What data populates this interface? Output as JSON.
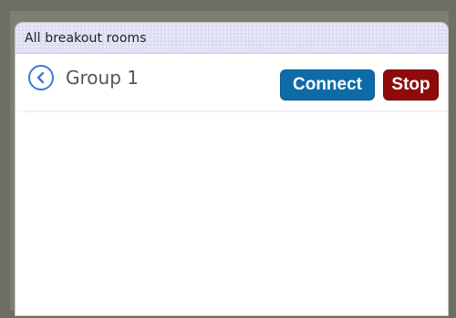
{
  "panel": {
    "title": "All breakout rooms"
  },
  "room": {
    "name": "Group 1",
    "connect_label": "Connect",
    "stop_label": "Stop"
  },
  "icons": {
    "back": "chevron-left-icon"
  },
  "colors": {
    "header_bg": "#dcdcf2",
    "connect_bg": "#0f6aa8",
    "stop_bg": "#8e0b0b",
    "back_icon": "#3b7ad6",
    "frame": "#7f7e72"
  }
}
